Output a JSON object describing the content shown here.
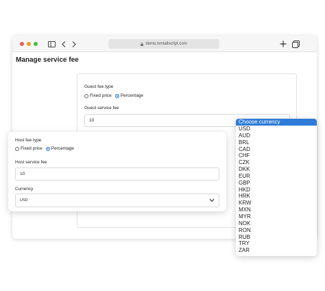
{
  "browser": {
    "url": "demo.rentallscript.com",
    "page_title": "Manage service fee"
  },
  "guest_fee": {
    "type_label": "Guest fee type",
    "option_fixed": "Fixed price",
    "option_percentage": "Percentage",
    "selected": "Percentage",
    "service_fee_label": "Guest service fee",
    "service_fee_value": "10"
  },
  "host_fee": {
    "type_label": "Host fee type",
    "option_fixed": "Fixed price",
    "option_percentage": "Percentage",
    "selected": "Percentage",
    "service_fee_label": "Host service fee",
    "service_fee_value": "10",
    "currency_label": "Currency",
    "currency_value": "USD"
  },
  "currency_dropdown": {
    "header": "Choose currency",
    "options": [
      "USD",
      "AUD",
      "BRL",
      "CAD",
      "CHF",
      "CZK",
      "DKK",
      "EUR",
      "GBP",
      "HKD",
      "HRK",
      "KRW",
      "MXN",
      "MYR",
      "NOK",
      "RON",
      "RUB",
      "TRY",
      "ZAR"
    ]
  },
  "colors": {
    "accent": "#2f7bd8",
    "close_dot": "#ee5c55",
    "minimize_dot": "#e3a31f",
    "maximize_dot": "#52b947"
  }
}
